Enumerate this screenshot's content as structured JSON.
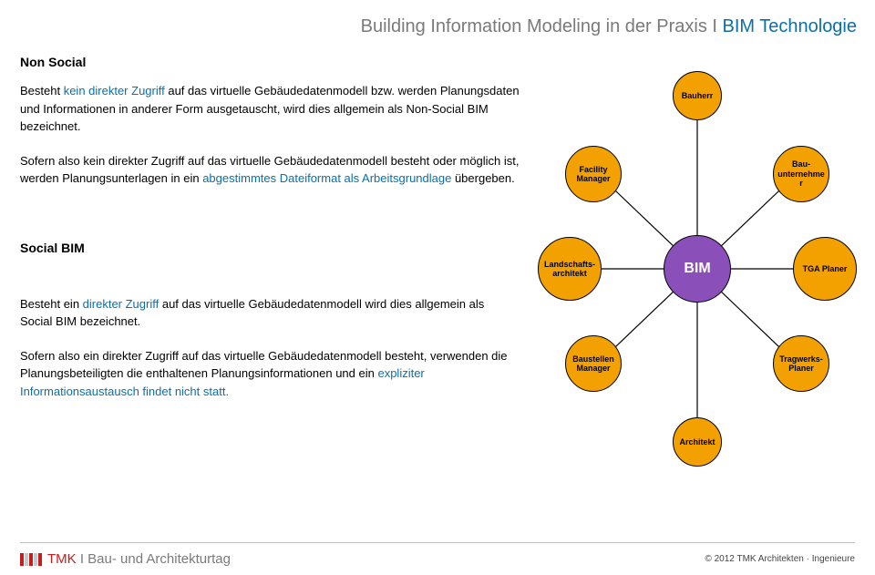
{
  "title": {
    "gray": "Building Information Modeling in der Praxis I ",
    "blue": "BIM Technologie"
  },
  "nonSocial": {
    "heading": "Non Social",
    "p1a": "Besteht ",
    "p1b": "kein direkter Zugriff",
    "p1c": " auf das virtuelle Gebäudedatenmodell bzw. werden Planungsdaten und Informationen in anderer Form ausgetauscht, wird dies allgemein als Non-Social BIM bezeichnet.",
    "p2a": "Sofern also kein direkter Zugriff auf das virtuelle Gebäudedatenmodell besteht oder möglich ist, werden Planungsunterlagen in ein ",
    "p2b": "abgestimmtes Dateiformat als Arbeitsgrundlage",
    "p2c": " übergeben."
  },
  "socialBIM": {
    "heading": "Social BIM",
    "p1a": "Besteht ein ",
    "p1b": "direkter Zugriff",
    "p1c": " auf das virtuelle Gebäudedatenmodell wird dies allgemein als Social BIM bezeichnet.",
    "p2a": "Sofern also ein direkter Zugriff auf das virtuelle Gebäudedatenmodell besteht, verwenden die Planungsbeteiligten die enthaltenen Planungsinformationen und ein ",
    "p2b": "expliziter Informationsaustausch findet nicht statt.",
    "p2c": ""
  },
  "nodes": {
    "bauherr": "Bauherr",
    "facility": "Facility\nManager",
    "bauunt": "Bau-\nunternehme\nr",
    "landschaft": "Landschafts-\narchitekt",
    "bim": "BIM",
    "tga": "TGA Planer",
    "baustellen": "Baustellen\nManager",
    "tragwerk": "Tragwerks-\nPlaner",
    "architekt": "Architekt"
  },
  "footer": {
    "leftRed": "TMK",
    "leftGray": " I Bau- und Architekturtag",
    "rightPrefix": "© 2012 TMK Architekten ",
    "rightRed": "·",
    "rightSuffix": " Ingenieure"
  }
}
